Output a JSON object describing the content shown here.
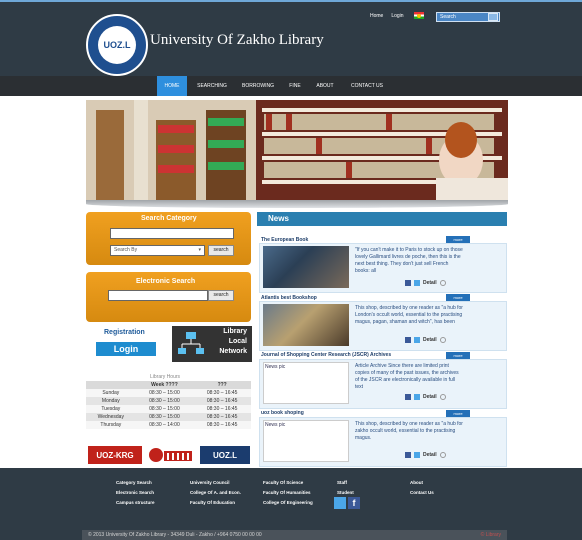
{
  "header": {
    "title": "University Of Zakho Library",
    "logo_text": "UOZ.L",
    "top_links": [
      "Home",
      "Login"
    ],
    "search_placeholder": "Search"
  },
  "nav": {
    "items": [
      "HOME",
      "SEARCHING",
      "BORROWING",
      "FINE",
      "ABOUT",
      "CONTACT US"
    ],
    "active": "HOME"
  },
  "search_category": {
    "title": "Search Category",
    "select_value": "Search By",
    "button": "search"
  },
  "electronic_search": {
    "title": "Electronic Search",
    "button": "search"
  },
  "registration": {
    "label": "Registration",
    "login_button": "Login"
  },
  "lln": {
    "line1": "Library",
    "line2": "Local",
    "line3": "Network"
  },
  "hours": {
    "title": "Library Hours",
    "headers": [
      "",
      "Week ????",
      "???"
    ],
    "rows": [
      [
        "Sunday",
        "08:30 – 15:00",
        "08:30 – 16:45"
      ],
      [
        "Monday",
        "08:30 – 15:00",
        "08:30 – 16:45"
      ],
      [
        "Tuesday",
        "08:30 – 15:00",
        "08:30 – 16:45"
      ],
      [
        "Wednesday",
        "08:30 – 15:00",
        "08:30 – 16:45"
      ],
      [
        "Thursday",
        "08:30 – 14:00",
        "08:30 – 16:45"
      ]
    ]
  },
  "partner_logos": [
    "UOZ-KRG",
    "UOZ.L"
  ],
  "news": {
    "title": "News",
    "more_label": "more",
    "detail_label": "Detail",
    "articles": [
      {
        "title": "The European Book",
        "text": "\"If you can't make it to Paris to stock up on those lovely Gallimard livres de poche, then this is the next best thing. They don't just sell French books: all",
        "image_alt": ""
      },
      {
        "title": "Atlantis best Bookshop",
        "text": "This shop, described by one reader as \"a hub for London's occult world, essential to the practising magus, pagan, shaman and witch\", has been",
        "image_alt": ""
      },
      {
        "title": "Journal of Shopping Center Research (JSCR) Archives",
        "text": "Article Archive Since there are limited print copies of many of the past issues, the archives of the JSCR are electronically available in full text",
        "image_alt": "News pic"
      },
      {
        "title": "uoz book shoping",
        "text": "This shop, described by one reader as \"a hub for zakho occult world, essential to the practising magus.",
        "image_alt": "News pic"
      }
    ]
  },
  "footer": {
    "col1": [
      "Category Search",
      "Electronic Search",
      "Campus structure"
    ],
    "col2": [
      "University Council",
      "College Of A. and Econ.",
      "Faculty Of Education"
    ],
    "col3": [
      "Faculty Of Science",
      "Faculty Of Humanities",
      "College Of Engineering"
    ],
    "col4": [
      "Staff",
      "Student"
    ],
    "col5": [
      "About",
      "Contact Us"
    ],
    "copyright": "© 2013 University Of Zakho Library - 34349 Duli - Zakho / +964 0750 00 00 00",
    "right_text": "© Library"
  }
}
